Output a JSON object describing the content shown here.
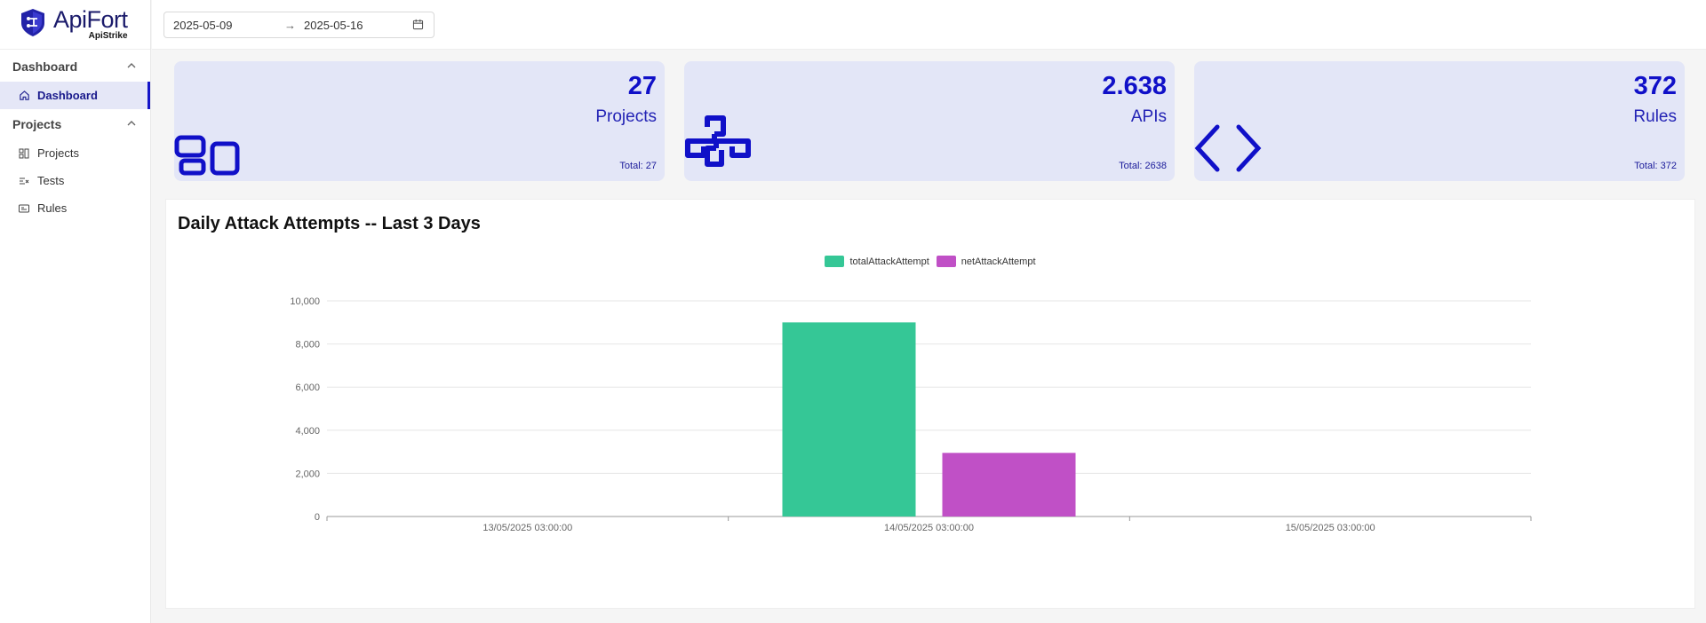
{
  "app": {
    "title": "ApiFort",
    "subtitle": "ApiStrike"
  },
  "sidebar": {
    "groups": [
      {
        "label": "Dashboard",
        "items": [
          {
            "label": "Dashboard",
            "icon": "home-icon",
            "active": true
          }
        ]
      },
      {
        "label": "Projects",
        "items": [
          {
            "label": "Projects",
            "icon": "projects-icon"
          },
          {
            "label": "Tests",
            "icon": "tests-icon"
          },
          {
            "label": "Rules",
            "icon": "rules-icon"
          }
        ]
      }
    ]
  },
  "date_range": {
    "start": "2025-05-09",
    "separator": "→",
    "end": "2025-05-16"
  },
  "cards": [
    {
      "value": "27",
      "label": "Projects",
      "total": "Total: 27",
      "icon": "dashboard-grid-icon"
    },
    {
      "value": "2.638",
      "label": "APIs",
      "total": "Total: 2638",
      "icon": "api-link-icon"
    },
    {
      "value": "372",
      "label": "Rules",
      "total": "Total: 372",
      "icon": "code-brackets-icon"
    }
  ],
  "colors": {
    "accent": "#1414c8",
    "card_bg": "#e3e6f7",
    "total_series": "#35c796",
    "net_series": "#c050c6"
  },
  "chart_title": "Daily Attack Attempts -- Last 3 Days",
  "chart_data": {
    "type": "bar",
    "title": "Daily Attack Attempts -- Last 3 Days",
    "categories": [
      "13/05/2025 03:00:00",
      "14/05/2025 03:00:00",
      "15/05/2025 03:00:00"
    ],
    "series": [
      {
        "name": "totalAttackAttempt",
        "values": [
          0,
          9000,
          0
        ],
        "color": "#35c796"
      },
      {
        "name": "netAttackAttempt",
        "values": [
          0,
          2950,
          0
        ],
        "color": "#c050c6"
      }
    ],
    "ylim": [
      0,
      10000
    ],
    "yticks": [
      "0",
      "2,000",
      "4,000",
      "6,000",
      "8,000",
      "10,000"
    ],
    "grid": true,
    "legend": "top-center"
  }
}
